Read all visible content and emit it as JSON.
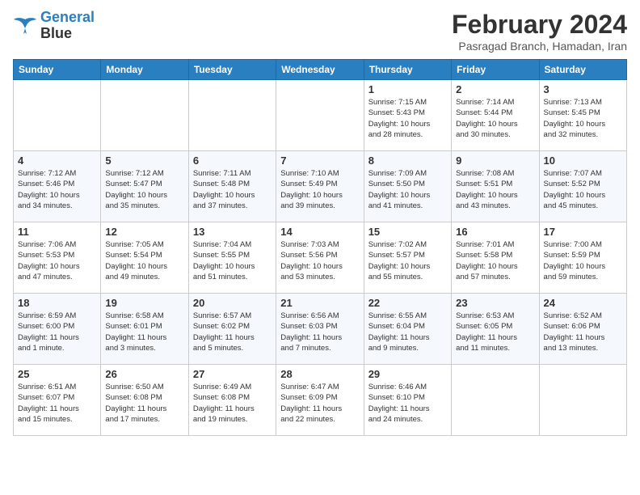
{
  "logo": {
    "line1": "General",
    "line2": "Blue"
  },
  "title": "February 2024",
  "subtitle": "Pasragad Branch, Hamadan, Iran",
  "weekdays": [
    "Sunday",
    "Monday",
    "Tuesday",
    "Wednesday",
    "Thursday",
    "Friday",
    "Saturday"
  ],
  "weeks": [
    [
      {
        "day": "",
        "info": ""
      },
      {
        "day": "",
        "info": ""
      },
      {
        "day": "",
        "info": ""
      },
      {
        "day": "",
        "info": ""
      },
      {
        "day": "1",
        "info": "Sunrise: 7:15 AM\nSunset: 5:43 PM\nDaylight: 10 hours\nand 28 minutes."
      },
      {
        "day": "2",
        "info": "Sunrise: 7:14 AM\nSunset: 5:44 PM\nDaylight: 10 hours\nand 30 minutes."
      },
      {
        "day": "3",
        "info": "Sunrise: 7:13 AM\nSunset: 5:45 PM\nDaylight: 10 hours\nand 32 minutes."
      }
    ],
    [
      {
        "day": "4",
        "info": "Sunrise: 7:12 AM\nSunset: 5:46 PM\nDaylight: 10 hours\nand 34 minutes."
      },
      {
        "day": "5",
        "info": "Sunrise: 7:12 AM\nSunset: 5:47 PM\nDaylight: 10 hours\nand 35 minutes."
      },
      {
        "day": "6",
        "info": "Sunrise: 7:11 AM\nSunset: 5:48 PM\nDaylight: 10 hours\nand 37 minutes."
      },
      {
        "day": "7",
        "info": "Sunrise: 7:10 AM\nSunset: 5:49 PM\nDaylight: 10 hours\nand 39 minutes."
      },
      {
        "day": "8",
        "info": "Sunrise: 7:09 AM\nSunset: 5:50 PM\nDaylight: 10 hours\nand 41 minutes."
      },
      {
        "day": "9",
        "info": "Sunrise: 7:08 AM\nSunset: 5:51 PM\nDaylight: 10 hours\nand 43 minutes."
      },
      {
        "day": "10",
        "info": "Sunrise: 7:07 AM\nSunset: 5:52 PM\nDaylight: 10 hours\nand 45 minutes."
      }
    ],
    [
      {
        "day": "11",
        "info": "Sunrise: 7:06 AM\nSunset: 5:53 PM\nDaylight: 10 hours\nand 47 minutes."
      },
      {
        "day": "12",
        "info": "Sunrise: 7:05 AM\nSunset: 5:54 PM\nDaylight: 10 hours\nand 49 minutes."
      },
      {
        "day": "13",
        "info": "Sunrise: 7:04 AM\nSunset: 5:55 PM\nDaylight: 10 hours\nand 51 minutes."
      },
      {
        "day": "14",
        "info": "Sunrise: 7:03 AM\nSunset: 5:56 PM\nDaylight: 10 hours\nand 53 minutes."
      },
      {
        "day": "15",
        "info": "Sunrise: 7:02 AM\nSunset: 5:57 PM\nDaylight: 10 hours\nand 55 minutes."
      },
      {
        "day": "16",
        "info": "Sunrise: 7:01 AM\nSunset: 5:58 PM\nDaylight: 10 hours\nand 57 minutes."
      },
      {
        "day": "17",
        "info": "Sunrise: 7:00 AM\nSunset: 5:59 PM\nDaylight: 10 hours\nand 59 minutes."
      }
    ],
    [
      {
        "day": "18",
        "info": "Sunrise: 6:59 AM\nSunset: 6:00 PM\nDaylight: 11 hours\nand 1 minute."
      },
      {
        "day": "19",
        "info": "Sunrise: 6:58 AM\nSunset: 6:01 PM\nDaylight: 11 hours\nand 3 minutes."
      },
      {
        "day": "20",
        "info": "Sunrise: 6:57 AM\nSunset: 6:02 PM\nDaylight: 11 hours\nand 5 minutes."
      },
      {
        "day": "21",
        "info": "Sunrise: 6:56 AM\nSunset: 6:03 PM\nDaylight: 11 hours\nand 7 minutes."
      },
      {
        "day": "22",
        "info": "Sunrise: 6:55 AM\nSunset: 6:04 PM\nDaylight: 11 hours\nand 9 minutes."
      },
      {
        "day": "23",
        "info": "Sunrise: 6:53 AM\nSunset: 6:05 PM\nDaylight: 11 hours\nand 11 minutes."
      },
      {
        "day": "24",
        "info": "Sunrise: 6:52 AM\nSunset: 6:06 PM\nDaylight: 11 hours\nand 13 minutes."
      }
    ],
    [
      {
        "day": "25",
        "info": "Sunrise: 6:51 AM\nSunset: 6:07 PM\nDaylight: 11 hours\nand 15 minutes."
      },
      {
        "day": "26",
        "info": "Sunrise: 6:50 AM\nSunset: 6:08 PM\nDaylight: 11 hours\nand 17 minutes."
      },
      {
        "day": "27",
        "info": "Sunrise: 6:49 AM\nSunset: 6:08 PM\nDaylight: 11 hours\nand 19 minutes."
      },
      {
        "day": "28",
        "info": "Sunrise: 6:47 AM\nSunset: 6:09 PM\nDaylight: 11 hours\nand 22 minutes."
      },
      {
        "day": "29",
        "info": "Sunrise: 6:46 AM\nSunset: 6:10 PM\nDaylight: 11 hours\nand 24 minutes."
      },
      {
        "day": "",
        "info": ""
      },
      {
        "day": "",
        "info": ""
      }
    ]
  ]
}
